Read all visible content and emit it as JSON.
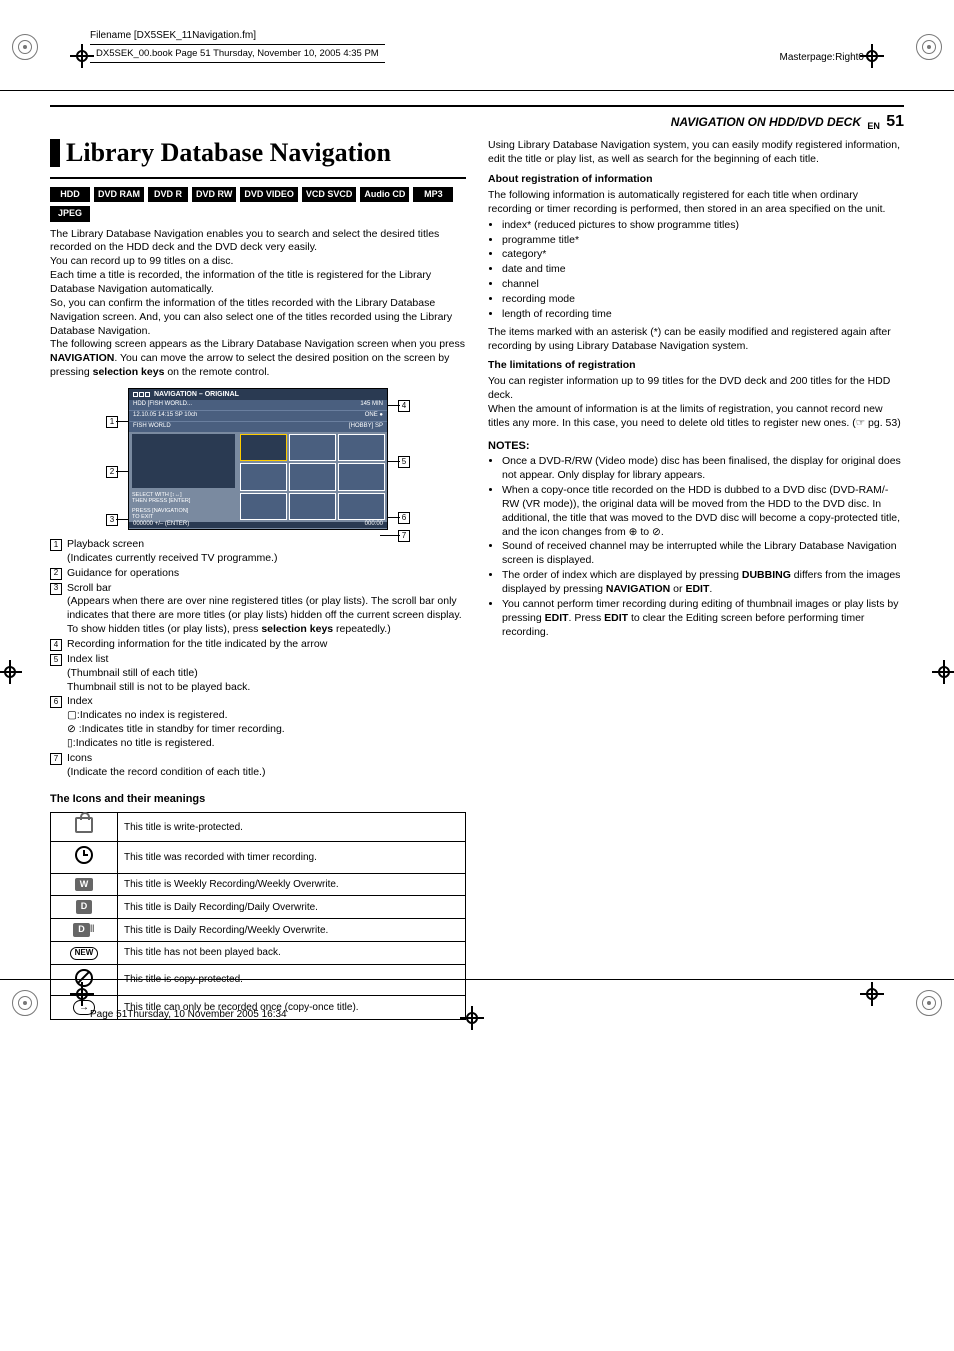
{
  "meta": {
    "filename": "Filename [DX5SEK_11Navigation.fm]",
    "bookline": "DX5SEK_00.book  Page 51  Thursday, November 10, 2005  4:35 PM",
    "masterpage": "Masterpage:Right0",
    "footer": "Page 51Thursday, 10 November 2005  16:34"
  },
  "header": {
    "section": "NAVIGATION ON HDD/DVD DECK",
    "en": "EN",
    "page": "51"
  },
  "title": "Library Database Navigation",
  "formats": [
    "HDD",
    "DVD RAM",
    "DVD R",
    "DVD RW",
    "DVD VIDEO",
    "VCD SVCD",
    "Audio CD",
    "MP3",
    "JPEG"
  ],
  "intro": "The Library Database Navigation enables you to search and select the desired titles recorded on the HDD deck and the DVD deck very easily.",
  "intro2": "You can record up to 99 titles on a disc.",
  "intro3": "Each time a title is recorded, the information of the title is registered for the Library Database Navigation automatically.",
  "intro4": "So, you can confirm the information of the titles recorded with the Library Database Navigation screen. And, you can also select one of the titles recorded using the Library Database Navigation.",
  "intro5_a": "The following screen appears as the Library Database Navigation screen when you press ",
  "intro5_b": "NAVIGATION",
  "intro5_c": ". You can move the arrow to select the desired position on the screen by pressing ",
  "intro5_d": "selection keys",
  "intro5_e": " on the remote control.",
  "navscreen": {
    "header": "NAVIGATION – ORIGINAL",
    "info1_l": "HDD   [FISH WORLD...",
    "info1_r": "145 MIN",
    "info2_l": "12.10.05  14:15 SP     10ch",
    "info2_r": "ONE ●",
    "info3_l": "FISH WORLD",
    "info3_r": "[HOBBY] SP",
    "guide1": "SELECT WITH [↕↔]\nTHEN PRESS [ENTER]",
    "guide2": "PRESS [NAVIGATION]\nTO EXIT",
    "scroll_l": "000000     +/– (ENTER)",
    "scroll_icons": "HDD ◄     ►",
    "scroll_r": "000:00"
  },
  "legend": [
    {
      "n": "1",
      "t": "Playback screen",
      "sub": "(Indicates currently received TV programme.)"
    },
    {
      "n": "2",
      "t": "Guidance for operations",
      "sub": ""
    },
    {
      "n": "3",
      "t": "Scroll bar",
      "sub": "(Appears when there are over nine registered titles (or play lists). The scroll bar only indicates that there are more titles (or play lists) hidden off the current screen display. To show hidden titles (or play lists), press selection keys repeatedly.)"
    },
    {
      "n": "4",
      "t": "Recording information for the title indicated by the arrow",
      "sub": ""
    },
    {
      "n": "5",
      "t": "Index list",
      "sub": "(Thumbnail still of each title)\nThumbnail still is not to be played back."
    },
    {
      "n": "6",
      "t": "Index",
      "sub": "▢:Indicates no index is registered.\n⊘ :Indicates title in standby for timer recording.\n▯:Indicates no title is registered."
    },
    {
      "n": "7",
      "t": "Icons",
      "sub": "(Indicate the record condition of each title.)"
    }
  ],
  "icons_heading": "The Icons and their meanings",
  "icons_table": [
    {
      "icon": "lock",
      "text": "This title is write-protected."
    },
    {
      "icon": "clock",
      "text": "This title was recorded with timer recording."
    },
    {
      "icon": "W",
      "text": "This title is Weekly Recording/Weekly Overwrite."
    },
    {
      "icon": "D",
      "text": "This title is Daily Recording/Daily Overwrite."
    },
    {
      "icon": "DW",
      "text": "This title is Daily Recording/Weekly Overwrite."
    },
    {
      "icon": "NEW",
      "text": "This title has not been played back."
    },
    {
      "icon": "no",
      "text": "This title is copy-protected."
    },
    {
      "icon": "copy",
      "text": "This title can only be recorded once (copy-once title)."
    }
  ],
  "right": {
    "p1": "Using Library Database Navigation system, you can easily modify registered information, edit the title or play list, as well as search for the beginning of each title.",
    "h1": "About registration of information",
    "p2": "The following information is automatically registered for each title when ordinary recording or timer recording is performed, then stored in an area specified on the unit.",
    "reg_items": [
      "index* (reduced pictures to show programme titles)",
      "programme title*",
      "category*",
      "date and time",
      "channel",
      "recording mode",
      "length of recording time"
    ],
    "p3": "The items marked with an asterisk (*) can be easily modified and registered again after recording by using Library Database Navigation system.",
    "h2": "The limitations of registration",
    "p4": "You can register information up to 99 titles for the DVD deck and 200 titles for the HDD deck.",
    "p5": "When the amount of information is at the limits of registration, you cannot record new titles any more. In this case, you need to delete old titles to register new ones. (☞ pg. 53)",
    "notes_head": "NOTES:",
    "notes": [
      "Once a DVD-R/RW (Video mode) disc has been finalised, the display for original does not appear. Only display for library appears.",
      "When a copy-once title recorded on the HDD is dubbed to a DVD disc (DVD-RAM/-RW (VR mode)), the original data will be moved from the HDD to the DVD disc. In additional, the title that was moved to the DVD disc will become a copy-protected title, and the icon changes from ⊕ to ⊘.",
      "Sound of received channel may be interrupted while the Library Database Navigation screen is displayed.",
      "The order of index which are displayed by pressing DUBBING differs from the images displayed by pressing NAVIGATION or EDIT.",
      "You cannot perform timer recording during editing of thumbnail images or play lists by pressing EDIT. Press EDIT to clear the Editing screen before performing timer recording."
    ]
  }
}
